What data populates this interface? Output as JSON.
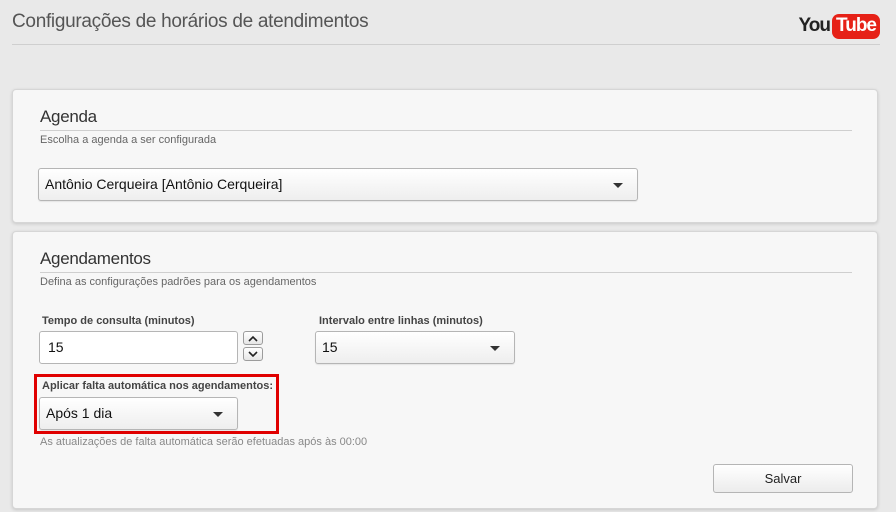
{
  "header": {
    "title": "Configurações de horários de atendimentos",
    "logo": {
      "you": "You",
      "tube": "Tube",
      "tube_color": "#e62117"
    }
  },
  "agenda_card": {
    "title": "Agenda",
    "subtitle": "Escolha a agenda a ser configurada",
    "agenda_select": {
      "value": "Antônio Cerqueira [Antônio Cerqueira]"
    }
  },
  "agendamentos_card": {
    "title": "Agendamentos",
    "subtitle": "Defina as configurações padrões para os agendamentos",
    "tempo_consulta": {
      "label": "Tempo de consulta (minutos)",
      "value": "15"
    },
    "intervalo_linhas": {
      "label": "Intervalo entre linhas (minutos)",
      "value": "15"
    },
    "falta_automatica": {
      "label": "Aplicar falta automática nos agendamentos:",
      "value": "Após 1 dia",
      "hint": "As atualizações de falta automática serão efetuadas após às 00:00",
      "highlight_color": "#e00000"
    },
    "save_label": "Salvar"
  }
}
